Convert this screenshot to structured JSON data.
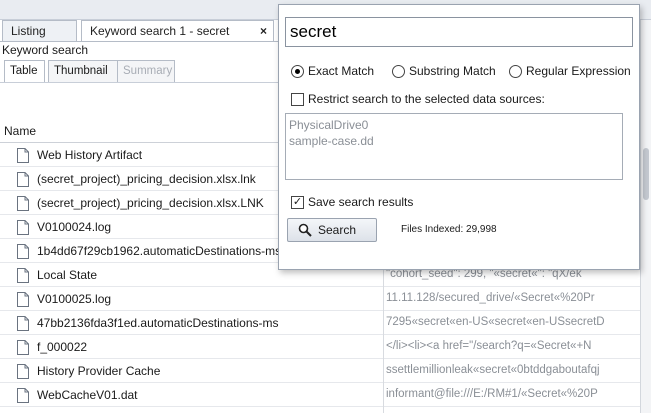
{
  "tabs": [
    {
      "label": "Listing"
    },
    {
      "label": "Keyword search 1 - secret",
      "close": "×"
    }
  ],
  "panel_title": "Keyword search",
  "subtabs": [
    {
      "label": "Table"
    },
    {
      "label": "Thumbnail"
    },
    {
      "label": "Summary"
    }
  ],
  "table": {
    "column_name": "Name",
    "rows": [
      {
        "name": "Web History Artifact",
        "preview": ""
      },
      {
        "name": "(secret_project)_pricing_decision.xlsx.lnk",
        "preview": ""
      },
      {
        "name": "(secret_project)_pricing_decision.xlsx.LNK",
        "preview": ""
      },
      {
        "name": "V0100024.log",
        "preview": ""
      },
      {
        "name": "1b4dd67f29cb1962.automaticDestinations-ms",
        "preview": ""
      },
      {
        "name": "Local State",
        "preview": "\"cohort_seed\": 299,    \"«secret«\": \"qX/ek"
      },
      {
        "name": "V0100025.log",
        "preview": "11.11.128/secured_drive/«Secret«%20Pr"
      },
      {
        "name": "47bb2136fda3f1ed.automaticDestinations-ms",
        "preview": "7295«secret«en-US«secret«en-USsecretD"
      },
      {
        "name": "f_000022",
        "preview": "</li><li><a href=\"/search?q=«Secret«+N"
      },
      {
        "name": "History Provider Cache",
        "preview": "ssettlemillionleak«secret«0btddgaboutafqj"
      },
      {
        "name": "WebCacheV01.dat",
        "preview": "informant@file:///E:/RM#1/«Secret«%20P"
      }
    ]
  },
  "popup": {
    "search_value": "secret",
    "radios": [
      {
        "label": "Exact Match",
        "selected": true
      },
      {
        "label": "Substring Match",
        "selected": false
      },
      {
        "label": "Regular Expression",
        "selected": false
      }
    ],
    "restrict_label": "Restrict search to the selected data sources:",
    "restrict_checked": false,
    "data_sources": [
      "PhysicalDrive0",
      "sample-case.dd"
    ],
    "save_label": "Save search results",
    "save_checked": true,
    "check_mark": "✓",
    "search_button": "Search",
    "files_indexed": "Files Indexed: 29,998"
  },
  "icons": {
    "file": "file-icon",
    "search": "magnifier-icon",
    "close": "close-icon"
  },
  "colors": {
    "border": "#9aa3b0",
    "muted_text": "#8a8f96",
    "tab_bg": "#eef1f5"
  }
}
